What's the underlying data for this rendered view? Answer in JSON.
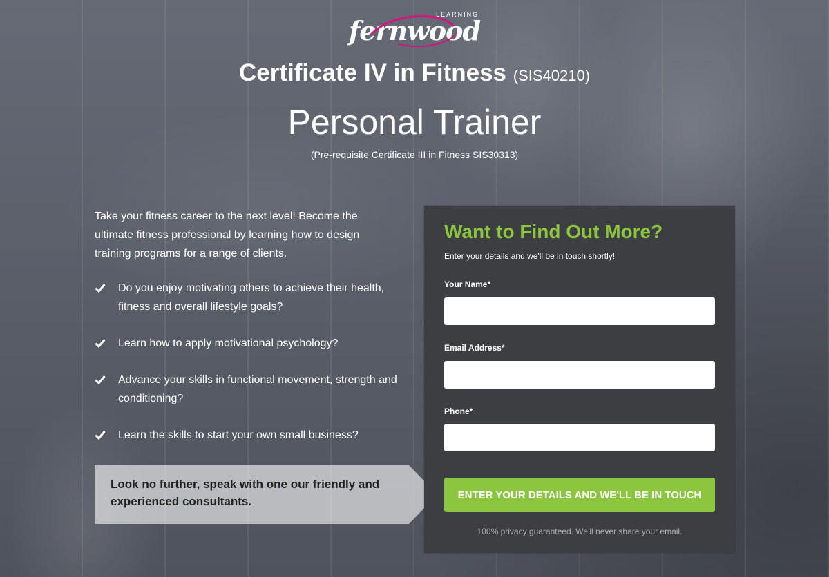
{
  "brand": {
    "logo_text": "fernwood",
    "logo_sub": "LEARNING",
    "accent": "#8cc63f",
    "logo_swoosh_color": "#d6137e"
  },
  "hero": {
    "title": "Certificate IV in Fitness",
    "code": "(SIS40210)",
    "subtitle": "Personal Trainer",
    "prerequisite": "(Pre-requisite Certificate III in Fitness SIS30313)"
  },
  "content": {
    "intro": "Take your fitness career to the next level! Become the ultimate fitness professional by learning how to design training programs for a range of clients.",
    "checks": [
      "Do you enjoy motivating others to achieve their health, fitness and overall lifestyle goals?",
      "Learn how to apply motivational psychology?",
      "Advance your skills in functional movement, strength and conditioning?",
      "Learn the skills to start your own small business?"
    ],
    "callout": "Look no further, speak with one our friendly and experienced consultants."
  },
  "form": {
    "title": "Want to Find Out More?",
    "subtitle": "Enter your details and we'll be in touch shortly!",
    "name_label": "Your Name*",
    "name_value": "",
    "email_label": "Email Address*",
    "email_value": "",
    "phone_label": "Phone*",
    "phone_value": "",
    "submit_label": "ENTER YOUR DETAILS AND WE'LL BE IN TOUCH",
    "privacy": "100% privacy guaranteed. We'll never share your email."
  }
}
